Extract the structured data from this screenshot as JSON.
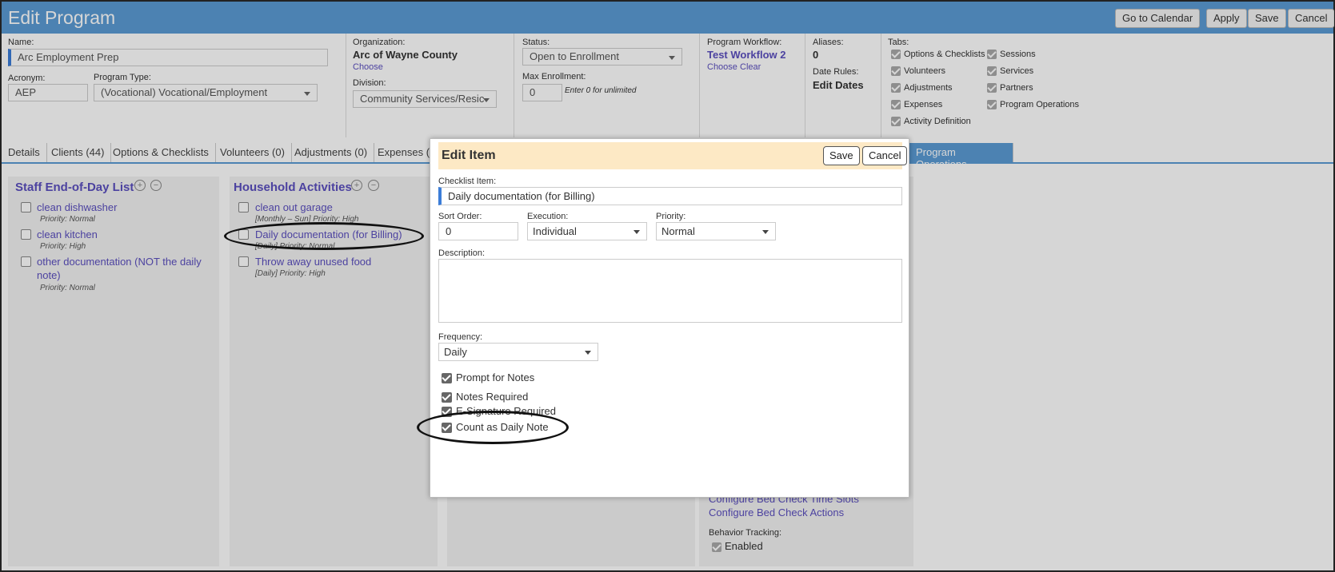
{
  "window": {
    "title": "Edit Program",
    "buttons": {
      "calendar": "Go to Calendar",
      "apply": "Apply",
      "save": "Save",
      "cancel": "Cancel"
    }
  },
  "form": {
    "name_label": "Name:",
    "name_value": "Arc Employment Prep",
    "acronym_label": "Acronym:",
    "acronym_value": "AEP",
    "program_type_label": "Program Type:",
    "program_type_value": "(Vocational) Vocational/Employment",
    "organization_label": "Organization:",
    "organization_value": "Arc of Wayne County",
    "organization_choose": "Choose",
    "division_label": "Division:",
    "division_value": "Community Services/Resic",
    "status_label": "Status:",
    "status_value": "Open to Enrollment",
    "max_enrollment_label": "Max Enrollment:",
    "max_enrollment_value": "0",
    "max_enrollment_hint": "Enter 0 for unlimited",
    "workflow_label": "Program Workflow:",
    "workflow_value": "Test Workflow 2",
    "workflow_choose": "Choose",
    "workflow_clear": "Clear",
    "aliases_label": "Aliases:",
    "aliases_value": "0",
    "date_rules_label": "Date Rules:",
    "date_rules_value": "Edit Dates",
    "tabs_label": "Tabs:",
    "tab_checks_col1": [
      "Options & Checklists",
      "Volunteers",
      "Adjustments",
      "Expenses",
      "Activity Definition"
    ],
    "tab_checks_col2": [
      "Sessions",
      "Services",
      "Partners",
      "Program Operations"
    ]
  },
  "tabs": [
    "Details",
    "Clients (44)",
    "Options & Checklists",
    "Volunteers (0)",
    "Adjustments (0)",
    "Expenses (",
    "Program Operations"
  ],
  "lists": {
    "staff": {
      "title": "Staff End-of-Day List",
      "items": [
        {
          "name": "clean dishwasher",
          "meta": "Priority: Normal"
        },
        {
          "name": "clean kitchen",
          "meta": "Priority: High"
        },
        {
          "name": "other documentation (NOT the daily",
          "name2": "note)",
          "meta": "Priority: Normal"
        }
      ]
    },
    "household": {
      "title": "Household Activities",
      "items": [
        {
          "name": "clean out garage",
          "meta": "[Monthly – Sun] Priority: High"
        },
        {
          "name": "Daily documentation (for Billing)",
          "meta": "[Daily] Priority: Normal"
        },
        {
          "name": "Throw away unused food",
          "meta": "[Daily] Priority: High"
        }
      ]
    },
    "operations": {
      "link1": "Configure Bed Check Time Slots",
      "link2": "Configure Bed Check Actions",
      "behavior_label": "Behavior Tracking:",
      "behavior_enabled": "Enabled"
    }
  },
  "dialog": {
    "title": "Edit Item",
    "save": "Save",
    "cancel": "Cancel",
    "checklist_label": "Checklist Item:",
    "checklist_value": "Daily documentation (for Billing)",
    "sort_label": "Sort Order:",
    "sort_value": "0",
    "execution_label": "Execution:",
    "execution_value": "Individual",
    "priority_label": "Priority:",
    "priority_value": "Normal",
    "description_label": "Description:",
    "frequency_label": "Frequency:",
    "frequency_value": "Daily",
    "checks": [
      "Prompt for Notes",
      "Notes Required",
      "E-Signature Required",
      "Count as Daily Note"
    ]
  }
}
